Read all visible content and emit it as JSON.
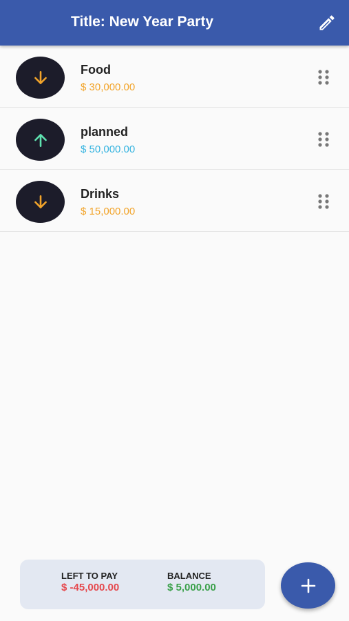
{
  "app_bar": {
    "title": "Title: New Year Party",
    "edit_icon": "pencil-icon",
    "background": "#3a5aab"
  },
  "items": [
    {
      "name": "Food",
      "amount": "$ 30,000.00",
      "direction": "down",
      "icon": "arrow-down-icon",
      "color": "#f2a42a"
    },
    {
      "name": "planned",
      "amount": "$ 50,000.00",
      "direction": "up",
      "icon": "arrow-up-icon",
      "color": "#36b4e0"
    },
    {
      "name": "Drinks",
      "amount": "$ 15,000.00",
      "direction": "down",
      "icon": "arrow-down-icon",
      "color": "#f2a42a"
    }
  ],
  "summary": {
    "left_to_pay_label": "LEFT TO PAY",
    "left_to_pay_value": "$ -45,000.00",
    "left_to_pay_color": "#e5484d",
    "balance_label": "BALANCE",
    "balance_value": "$ 5,000.00",
    "balance_color": "#3aa04a"
  },
  "fab": {
    "icon": "plus-icon"
  },
  "colors": {
    "arrow_down": "#f2a42a",
    "arrow_up": "#5fe3b0",
    "avatar_bg": "#1c1c2a"
  }
}
